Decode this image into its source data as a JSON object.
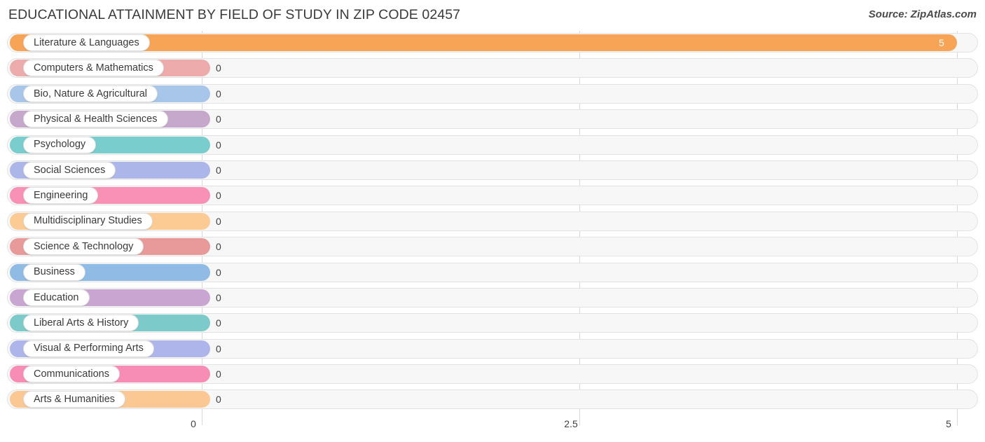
{
  "header": {
    "title": "EDUCATIONAL ATTAINMENT BY FIELD OF STUDY IN ZIP CODE 02457",
    "source": "Source: ZipAtlas.com"
  },
  "chart_data": {
    "type": "bar",
    "orientation": "horizontal",
    "title": "EDUCATIONAL ATTAINMENT BY FIELD OF STUDY IN ZIP CODE 02457",
    "xlabel": "",
    "ylabel": "",
    "xlim": [
      0,
      5
    ],
    "grid": true,
    "legend": "none",
    "ticks": [
      "0",
      "2.5",
      "5"
    ],
    "tick_values": [
      0,
      2.5,
      5
    ],
    "categories": [
      "Literature & Languages",
      "Computers & Mathematics",
      "Bio, Nature & Agricultural",
      "Physical & Health Sciences",
      "Psychology",
      "Social Sciences",
      "Engineering",
      "Multidisciplinary Studies",
      "Science & Technology",
      "Business",
      "Education",
      "Liberal Arts & History",
      "Visual & Performing Arts",
      "Communications",
      "Arts & Humanities"
    ],
    "values": [
      5,
      0,
      0,
      0,
      0,
      0,
      0,
      0,
      0,
      0,
      0,
      0,
      0,
      0,
      0
    ],
    "value_labels": [
      "5",
      "0",
      "0",
      "0",
      "0",
      "0",
      "0",
      "0",
      "0",
      "0",
      "0",
      "0",
      "0",
      "0",
      "0"
    ],
    "colors": [
      "#f7a456",
      "#eeabab",
      "#a8c6ea",
      "#c7a8cd",
      "#79cdcd",
      "#adb6e8",
      "#f891b5",
      "#fbcb93",
      "#e89a9a",
      "#8fbbe4",
      "#c9a6d2",
      "#7ccac9",
      "#aeb5ea",
      "#f78cb4",
      "#fbc893"
    ]
  },
  "axis": {
    "labels": [
      "0",
      "2.5",
      "5"
    ]
  }
}
